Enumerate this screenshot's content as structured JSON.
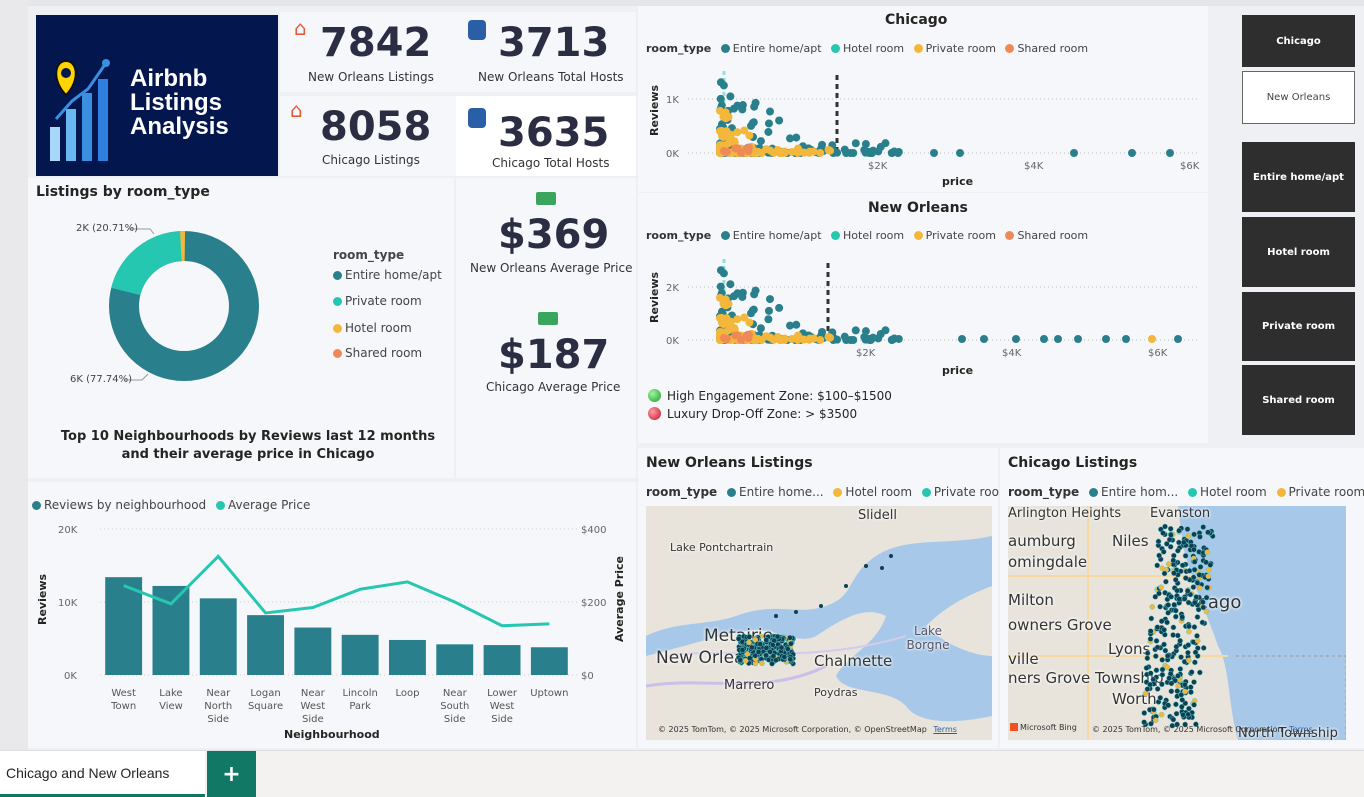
{
  "logo": {
    "line1": "Airbnb",
    "line2": "Listings",
    "line3": "Analysis"
  },
  "kpis": {
    "no_listings": {
      "value": "7842",
      "label": "New Orleans Listings",
      "icon": "house-icon"
    },
    "no_hosts": {
      "value": "3713",
      "label": "New Orleans Total Hosts",
      "icon": "host-icon"
    },
    "chi_listings": {
      "value": "8058",
      "label": "Chicago Listings",
      "icon": "house-icon"
    },
    "chi_hosts": {
      "value": "3635",
      "label": "Chicago Total Hosts",
      "icon": "host-icon"
    },
    "no_price": {
      "value": "$369",
      "label": "New Orleans Average Price",
      "icon": "money-icon"
    },
    "chi_price": {
      "value": "$187",
      "label": "Chicago Average Price",
      "icon": "money-icon"
    }
  },
  "donut": {
    "title": "Listings by room_type",
    "legend_title": "room_type",
    "legend": [
      "Entire home/apt",
      "Private room",
      "Hotel room",
      "Shared room"
    ],
    "label_top": "2K (20.71%)",
    "label_bottom": "6K (77.74%)"
  },
  "colors": {
    "entire": "#2a7f8c",
    "hotel": "#25c7b0",
    "private": "#f2b73b",
    "shared": "#ef8a57",
    "dark_navy": "#03164e"
  },
  "scatter_legend": {
    "title": "room_type",
    "items": [
      "Entire home/apt",
      "Hotel room",
      "Private room",
      "Shared room"
    ]
  },
  "scatter_chicago": {
    "title": "Chicago",
    "ylabel": "Reviews",
    "xlabel": "price",
    "yticks": [
      "1K",
      "0K"
    ],
    "xticks": [
      "$2K",
      "$4K",
      "$6K"
    ]
  },
  "scatter_no": {
    "title": "New Orleans",
    "ylabel": "Reviews",
    "xlabel": "price",
    "yticks": [
      "2K",
      "0K"
    ],
    "xticks": [
      "$2K",
      "$4K",
      "$6K"
    ]
  },
  "zones": {
    "high": "High Engagement Zone: $100–$1500",
    "lux": "Luxury Drop-Off Zone: > $3500"
  },
  "slicers": [
    "Chicago",
    "New Orleans",
    "Entire home/apt",
    "Hotel room",
    "Private room",
    "Shared room"
  ],
  "bar_title": "Top 10 Neighbourhoods by Reviews last 12 months and their average price in Chicago",
  "bar_legend": {
    "reviews": "Reviews by neighbourhood",
    "price": "Average Price"
  },
  "bar_axes": {
    "ylabel": "Reviews",
    "y2label": "Average Price",
    "xlabel": "Neighbourhood",
    "yticks": [
      "20K",
      "10K",
      "0K"
    ],
    "y2ticks": [
      "$400",
      "$200",
      "$0"
    ]
  },
  "chart_data": {
    "type": "bar",
    "title": "Top 10 Neighbourhoods by Reviews last 12 months and their average price in Chicago",
    "xlabel": "Neighbourhood",
    "ylabel": "Reviews",
    "ylim": [
      0,
      20000
    ],
    "y2label": "Average Price",
    "y2lim": [
      0,
      400
    ],
    "categories": [
      "West Town",
      "Lake View",
      "Near North Side",
      "Logan Square",
      "Near West Side",
      "Lincoln Park",
      "Loop",
      "Near South Side",
      "Lower West Side",
      "Uptown"
    ],
    "series": [
      {
        "name": "Reviews by neighbourhood",
        "type": "bar",
        "values": [
          13400,
          12200,
          10500,
          8200,
          6500,
          5500,
          4800,
          4200,
          4100,
          3800
        ]
      },
      {
        "name": "Average Price",
        "type": "line",
        "values": [
          245,
          195,
          325,
          170,
          185,
          235,
          255,
          200,
          135,
          140
        ]
      }
    ],
    "legend": "top-left"
  },
  "map_no": {
    "title": "New Orleans Listings",
    "legend_title": "room_type",
    "legend": [
      "Entire home...",
      "Hotel room",
      "Private room"
    ],
    "places": [
      "Slidell",
      "Lake Pontchartrain",
      "Metairie",
      "New Orleans",
      "Chalmette",
      "Lake Borgne",
      "Marrero",
      "Poydras"
    ],
    "copyright": "© 2025 TomTom, © 2025 Microsoft Corporation, © OpenStreetMap",
    "terms": "Terms"
  },
  "map_chi": {
    "title": "Chicago Listings",
    "legend_title": "room_type",
    "legend": [
      "Entire hom...",
      "Hotel room",
      "Private room"
    ],
    "places": [
      "Arlington Heights",
      "Evanston",
      "aumburg",
      "Niles",
      "omingdale",
      "Milton",
      "owners Grove",
      "Lyons",
      "ville",
      "ners Grove Township",
      "Worth",
      "North Township",
      "cago"
    ],
    "badge": "Microsoft Bing",
    "copyright": "© 2025 TomTom, © 2025 Microsoft Corporation",
    "terms": "Terms"
  },
  "tabs": {
    "page": "Chicago and New Orleans",
    "add": "+"
  }
}
